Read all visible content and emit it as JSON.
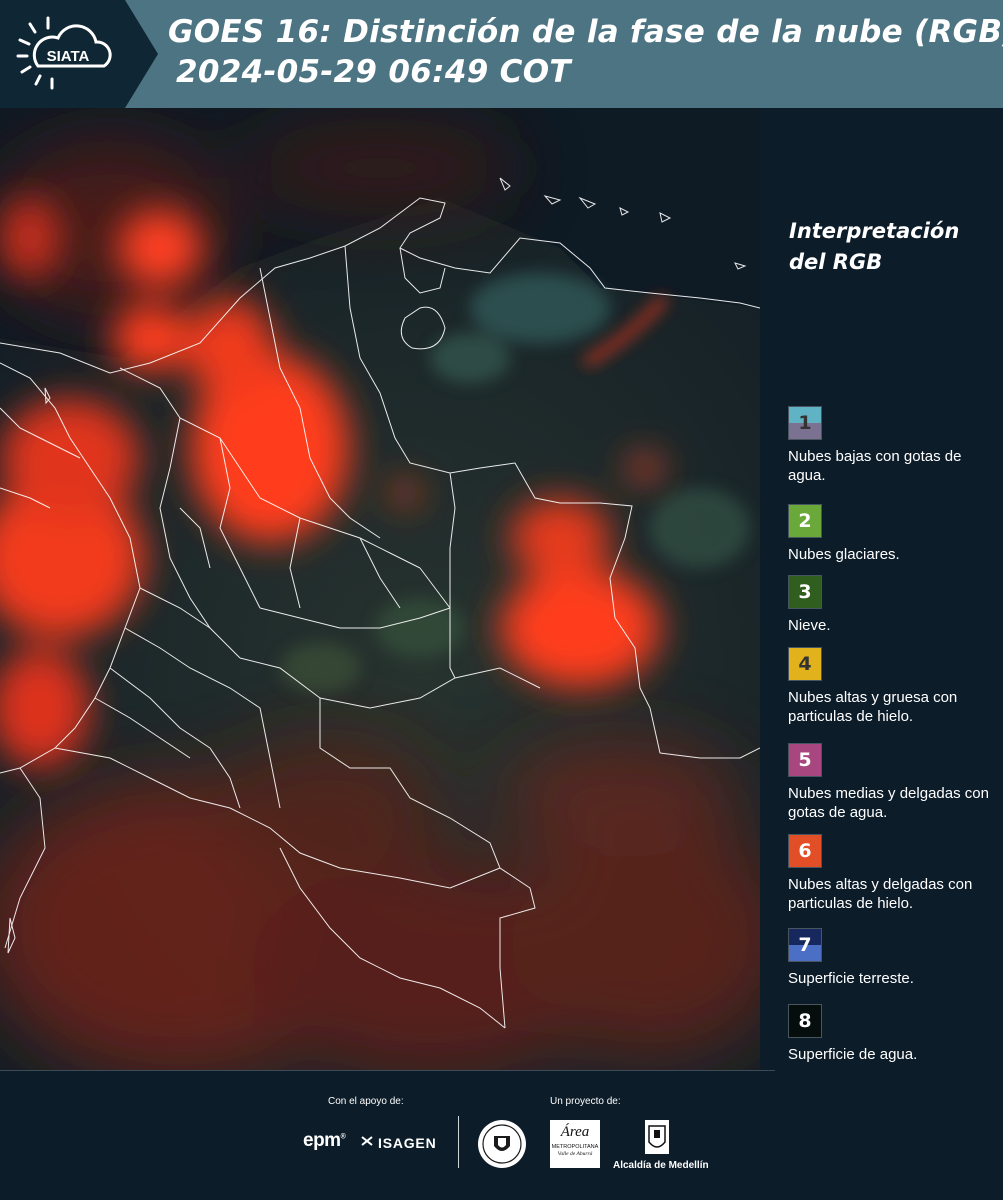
{
  "header": {
    "logo_text": "SIATA",
    "title_line1": "GOES 16: Distinción de la fase de la nube (RGB)",
    "title_line2": "2024-05-29 06:49 COT"
  },
  "legend": {
    "title_line1": "Interpretación",
    "title_line2": "del RGB",
    "items": [
      {
        "num": "1",
        "label": "Nubes bajas con gotas de agua.",
        "color_top": "#5fb3c4",
        "color_bottom": "#7a7290",
        "num_color": "#333333"
      },
      {
        "num": "2",
        "label": "Nubes glaciares.",
        "color_top": "#6aa83a",
        "color_bottom": "#6aa83a",
        "num_color": "#ffffff"
      },
      {
        "num": "3",
        "label": "Nieve.",
        "color_top": "#2f5e1f",
        "color_bottom": "#2f5e1f",
        "num_color": "#ffffff"
      },
      {
        "num": "4",
        "label": "Nubes altas y gruesa con particulas de hielo.",
        "color_top": "#e2b21d",
        "color_bottom": "#e2b21d",
        "num_color": "#333333"
      },
      {
        "num": "5",
        "label": "Nubes medias y delgadas con gotas de agua.",
        "color_top": "#a8477f",
        "color_bottom": "#a8477f",
        "num_color": "#ffffff"
      },
      {
        "num": "6",
        "label": "Nubes altas y delgadas con particulas de hielo.",
        "color_top": "#e24e26",
        "color_bottom": "#e24e26",
        "num_color": "#ffffff"
      },
      {
        "num": "7",
        "label": "Superficie terreste.",
        "color_top": "#16285e",
        "color_bottom": "#4a6fc4",
        "num_color": "#ffffff"
      },
      {
        "num": "8",
        "label": "Superficie de agua.",
        "color_top": "#050d0d",
        "color_bottom": "#050d0d",
        "num_color": "#ffffff"
      }
    ]
  },
  "footer": {
    "support_caption": "Con el apoyo de:",
    "project_caption": "Un proyecto de:",
    "epm": "epm",
    "isagen": "ISAGEN",
    "area_metro_lines": [
      "Área",
      "METROPOLITANA",
      "Valle de Aburrá"
    ],
    "alcaldia": "Alcaldía de Medellín"
  },
  "colors": {
    "header_bg": "#4d7483",
    "logo_bg": "#0f2634",
    "panel_bg": "#0c1c29",
    "cloud_red": "#ff3b1e"
  },
  "icons": [
    "siata-logo",
    "epm-logo",
    "isagen-logo",
    "university-seal",
    "area-metropolitana-logo",
    "alcaldia-medellin-logo"
  ]
}
